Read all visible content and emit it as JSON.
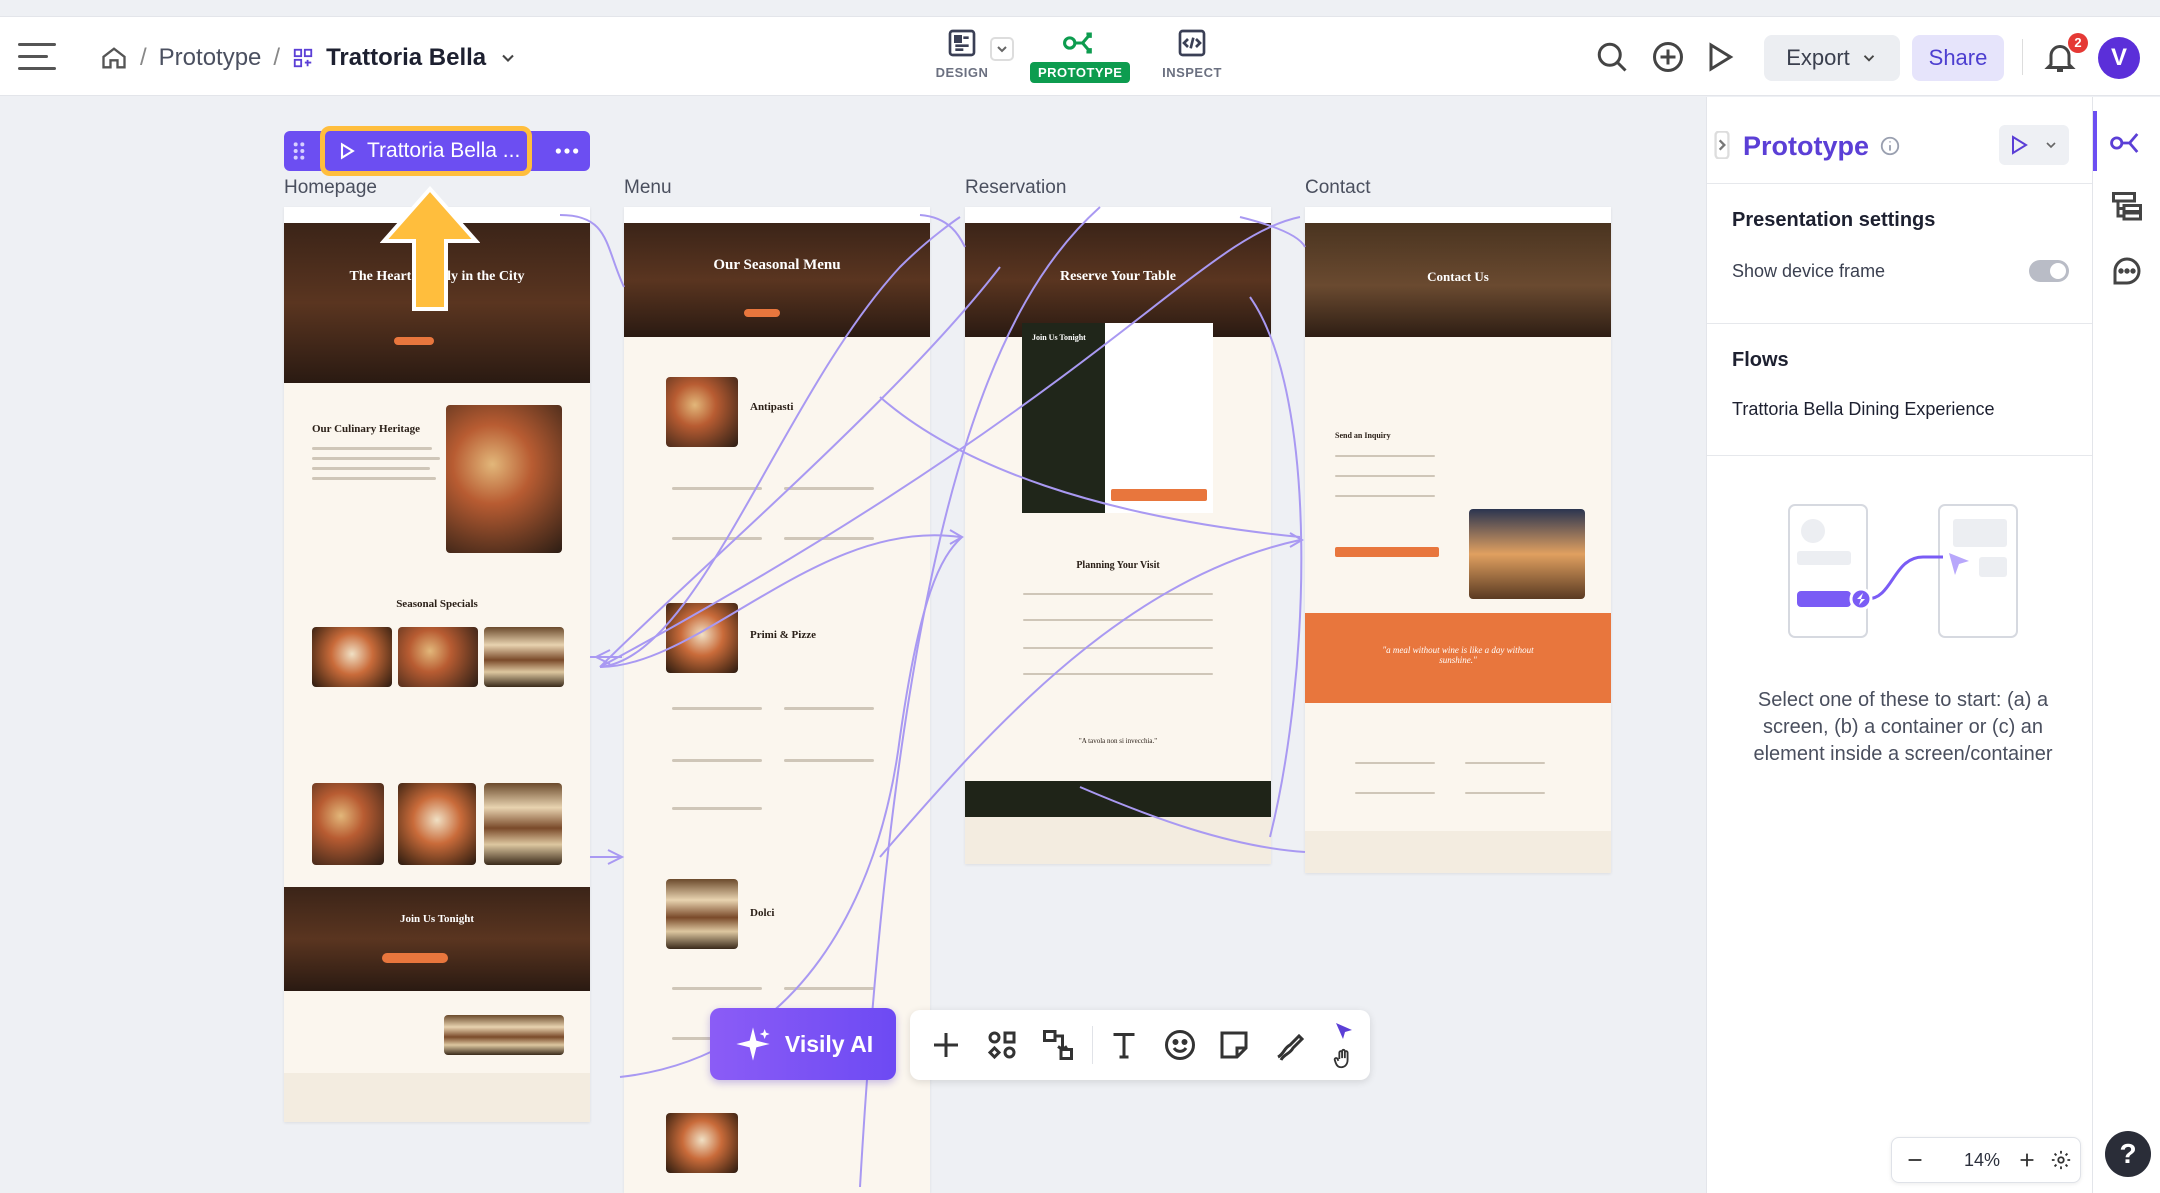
{
  "breadcrumb": {
    "project": "Prototype",
    "separator": "/",
    "file": "Trattoria Bella"
  },
  "modes": [
    {
      "label": "DESIGN"
    },
    {
      "label": "PROTOTYPE"
    },
    {
      "label": "INSPECT"
    }
  ],
  "actions": {
    "export_label": "Export",
    "share_label": "Share",
    "notification_count": "2",
    "avatar_letter": "V"
  },
  "canvas": {
    "selected_frame_play_label": "Trattoria Bella ...",
    "frames": [
      {
        "label": "Homepage"
      },
      {
        "label": "Menu"
      },
      {
        "label": "Reservation"
      },
      {
        "label": "Contact"
      }
    ],
    "screens": {
      "home_hero": "The Heart of Italy in the City",
      "home_heritage": "Our Culinary Heritage",
      "home_specials": "Seasonal Specials",
      "home_join": "Join Us Tonight",
      "menu_hero": "Our Seasonal Menu",
      "menu_antipasti": "Antipasti",
      "menu_primi": "Primi & Pizze",
      "menu_dolci": "Dolci",
      "res_hero": "Reserve Your Table",
      "res_join": "Join Us Tonight",
      "res_plan": "Planning Your Visit",
      "res_quote": "\"A tavola non si invecchia.\"",
      "contact_hero": "Contact Us",
      "contact_inquiry": "Send an Inquiry",
      "contact_quote": "\"a meal without wine is like a day without sunshine.\""
    }
  },
  "toolbar": {
    "ai_label": "Visily AI"
  },
  "panel": {
    "title": "Prototype",
    "presentation_settings": "Presentation settings",
    "show_device_frame": "Show device frame",
    "flows_heading": "Flows",
    "flow_name": "Trattoria Bella Dining Experience",
    "helper_text": "Select one of these to start: (a) a screen, (b) a container or (c) an element inside a screen/container",
    "zoom": "14%"
  },
  "colors": {
    "accent": "#6c4ef2",
    "prototype_green": "#0d9c4f",
    "highlight": "#ffbe3d",
    "brand_orange": "#e8763d"
  }
}
